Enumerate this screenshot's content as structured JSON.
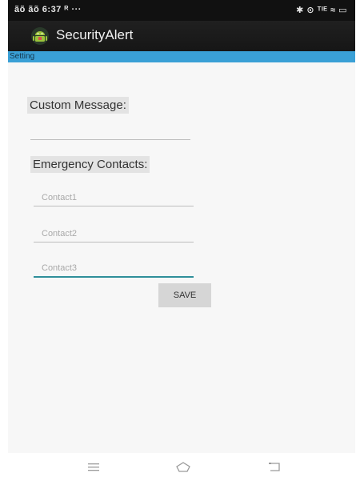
{
  "status_bar": {
    "left_text": "ãõ ãõ 6:37 ᴿ ···",
    "right_text": "✱ ⊙ ᵀᴵᴱ ≈ ▭"
  },
  "app": {
    "title": "SecurityAlert",
    "icon": "android-icon"
  },
  "screen": {
    "setting_label": "Setting"
  },
  "form": {
    "custom_message_label": "Custom Message:",
    "custom_message_value": "",
    "emergency_contacts_label": "Emergency Contacts:",
    "contacts": [
      {
        "placeholder": "Contact1",
        "value": ""
      },
      {
        "placeholder": "Contact2",
        "value": ""
      },
      {
        "placeholder": "Contact3",
        "value": ""
      }
    ],
    "save_label": "SAVE"
  },
  "nav_bar": {
    "icons": [
      "menu-icon",
      "home-icon",
      "back-icon"
    ]
  },
  "colors": {
    "status_bar_bg": "#111111",
    "action_bar_bg": "#1c1c1c",
    "setting_strip_bg": "#3aa0d6",
    "focus_underline": "#2f8f9a",
    "button_bg": "#d6d6d6",
    "app_icon_green": "#9bc33b"
  }
}
